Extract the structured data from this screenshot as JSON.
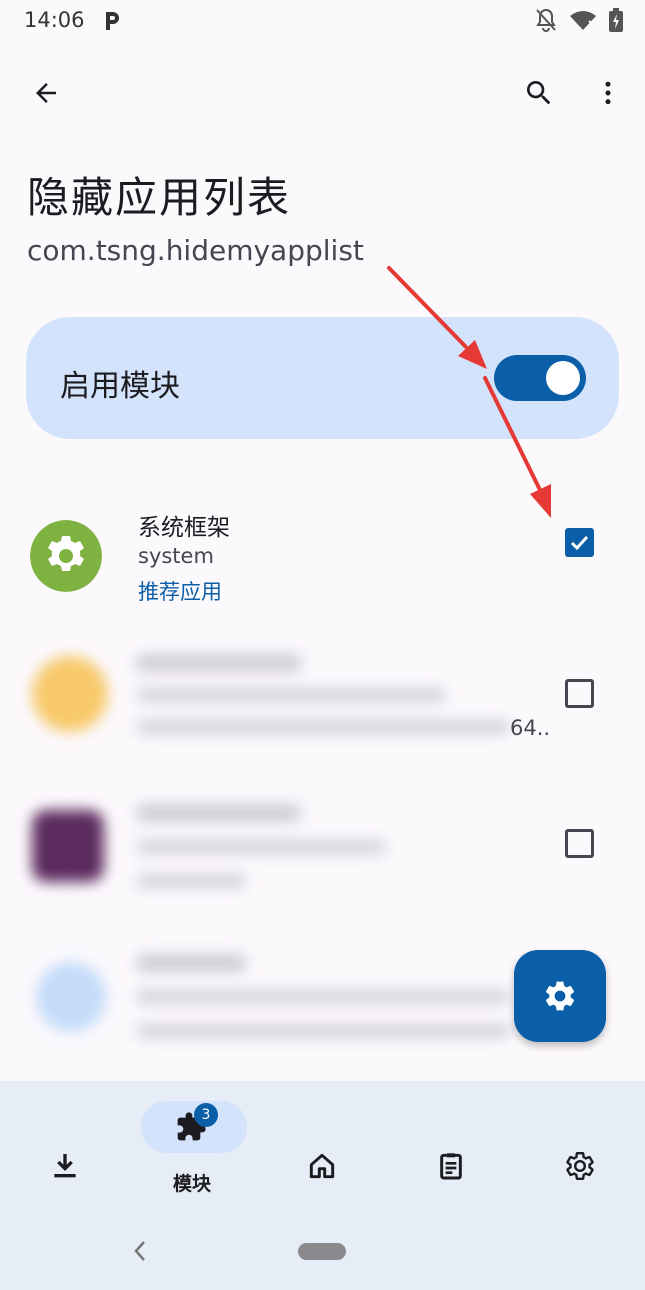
{
  "status_bar": {
    "time": "14:06",
    "icons": [
      "parking-icon",
      "notifications-off-icon",
      "wifi-icon",
      "battery-charging-icon"
    ]
  },
  "top_bar": {
    "back_icon": "arrow-back-icon",
    "search_icon": "search-icon",
    "more_icon": "more-vert-icon"
  },
  "header": {
    "title": "隐藏应用列表",
    "package": "com.tsng.hidemyapplist"
  },
  "enable_card": {
    "label": "启用模块",
    "enabled": true
  },
  "app_list": [
    {
      "name": "系统框架",
      "package": "system",
      "tag": "推荐应用",
      "checked": true,
      "icon": "settings-gear-icon"
    },
    {
      "trailing_text": "64..",
      "checked": false,
      "blurred": true
    },
    {
      "checked": false,
      "blurred": true
    },
    {
      "blurred": true
    }
  ],
  "fab": {
    "icon": "settings-gear-icon"
  },
  "bottom_nav": {
    "items": [
      {
        "id": "download",
        "icon": "download-icon",
        "label": ""
      },
      {
        "id": "modules",
        "icon": "extension-puzzle-icon",
        "label": "模块",
        "badge": "3",
        "active": true
      },
      {
        "id": "home",
        "icon": "home-icon",
        "label": ""
      },
      {
        "id": "logs",
        "icon": "clipboard-list-icon",
        "label": ""
      },
      {
        "id": "settings",
        "icon": "settings-gear-icon",
        "label": ""
      }
    ]
  },
  "colors": {
    "primary": "#0b5ea8",
    "card": "#d3e3fb",
    "background": "#fcf9fd",
    "nav_background": "#e7edf6",
    "annotation_arrow": "#e53935"
  }
}
